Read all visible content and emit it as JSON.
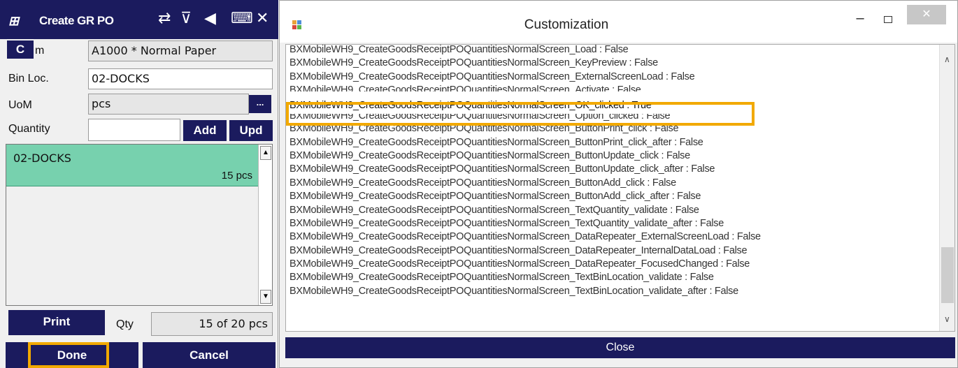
{
  "mobile": {
    "title": "Create GR PO",
    "header_icons": [
      "shuffle-icon",
      "filter-clear-icon",
      "speaker-icon",
      "keyboard-icon",
      "close-icon"
    ],
    "c_button": "C",
    "item_label_fragment": "m",
    "item_value": "A1000 * Normal Paper",
    "binloc_label": "Bin Loc.",
    "binloc_value": "02-DOCKS",
    "uom_label": "UoM",
    "uom_value": "pcs",
    "uom_button": "...",
    "quantity_label": "Quantity",
    "quantity_value": "",
    "add_label": "Add",
    "upd_label": "Upd",
    "list_rows": [
      {
        "location": "02-DOCKS",
        "amount": "15 pcs"
      }
    ],
    "print_label": "Print",
    "qty_label": "Qty",
    "qty_value": "15 of 20 pcs",
    "done_label": "Done",
    "cancel_label": "Cancel",
    "colors": {
      "navy": "#1b1b5e",
      "row": "#77d1ae",
      "highlight": "#f2a900"
    }
  },
  "customization": {
    "title": "Customization",
    "min_glyph": "–",
    "close_glyph": "✕",
    "lines": [
      "BXMobileWH9_CreateGoodsReceiptPOQuantitiesNormalScreen_Load : False",
      "BXMobileWH9_CreateGoodsReceiptPOQuantitiesNormalScreen_KeyPreview : False",
      "BXMobileWH9_CreateGoodsReceiptPOQuantitiesNormalScreen_ExternalScreenLoad : False",
      "BXMobileWH9_CreateGoodsReceiptPOQuantitiesNormalScreen_Activate : False",
      "BXMobileWH9_CreateGoodsReceiptPOQuantitiesNormalScreen_OK_clicked : True",
      "BXMobileWH9_CreateGoodsReceiptPOQuantitiesNormalScreen_Option_clicked : False",
      "BXMobileWH9_CreateGoodsReceiptPOQuantitiesNormalScreen_ButtonPrint_click : False",
      "BXMobileWH9_CreateGoodsReceiptPOQuantitiesNormalScreen_ButtonPrint_click_after : False",
      "BXMobileWH9_CreateGoodsReceiptPOQuantitiesNormalScreen_ButtonUpdate_click : False",
      "BXMobileWH9_CreateGoodsReceiptPOQuantitiesNormalScreen_ButtonUpdate_click_after : False",
      "BXMobileWH9_CreateGoodsReceiptPOQuantitiesNormalScreen_ButtonAdd_click : False",
      "BXMobileWH9_CreateGoodsReceiptPOQuantitiesNormalScreen_ButtonAdd_click_after : False",
      "BXMobileWH9_CreateGoodsReceiptPOQuantitiesNormalScreen_TextQuantity_validate : False",
      "BXMobileWH9_CreateGoodsReceiptPOQuantitiesNormalScreen_TextQuantity_validate_after : False",
      "BXMobileWH9_CreateGoodsReceiptPOQuantitiesNormalScreen_DataRepeater_ExternalScreenLoad : False",
      "BXMobileWH9_CreateGoodsReceiptPOQuantitiesNormalScreen_DataRepeater_InternalDataLoad : False",
      "BXMobileWH9_CreateGoodsReceiptPOQuantitiesNormalScreen_DataRepeater_FocusedChanged : False",
      "BXMobileWH9_CreateGoodsReceiptPOQuantitiesNormalScreen_TextBinLocation_validate : False",
      "BXMobileWH9_CreateGoodsReceiptPOQuantitiesNormalScreen_TextBinLocation_validate_after : False"
    ],
    "close_button": "Close"
  }
}
